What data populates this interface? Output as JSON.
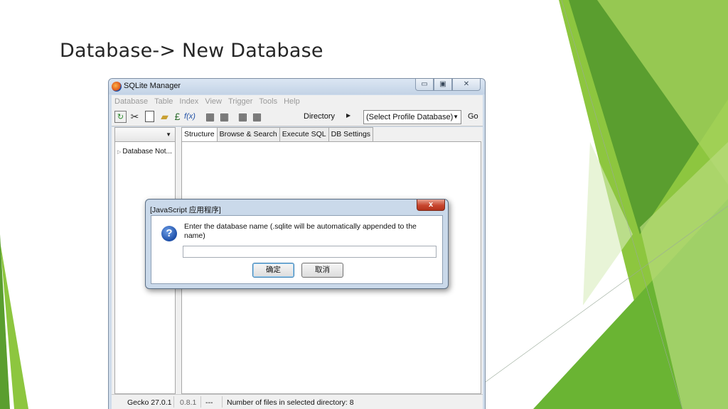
{
  "slide": {
    "title": "Database-> New Database"
  },
  "window": {
    "title": "SQLite Manager",
    "menus": [
      "Database",
      "Table",
      "Index",
      "View",
      "Trigger",
      "Tools",
      "Help"
    ],
    "toolbar": {
      "directory_label": "Directory",
      "profile_select": "(Select Profile Database)",
      "go_label": "Go",
      "icons": [
        "refresh-icon",
        "tools-icon",
        "new-file-icon",
        "open-folder-icon",
        "user-function-icon",
        "fx-icon",
        "create-table-icon",
        "drop-table-icon",
        "create-index-icon",
        "drop-index-icon"
      ]
    },
    "left_pane": {
      "tree_item": "Database Not..."
    },
    "tabs": [
      "Structure",
      "Browse & Search",
      "Execute SQL",
      "DB Settings"
    ],
    "status": {
      "gecko": "Gecko 27.0.1",
      "version": "0.8.1",
      "dashes": "---",
      "files": "Number of files in selected directory: 8"
    }
  },
  "dialog": {
    "title": "[JavaScript 应用程序]",
    "message": "Enter the database name (.sqlite will be automatically appended to the name)",
    "input_value": "",
    "ok_label": "确定",
    "cancel_label": "取消",
    "close_symbol": "x"
  },
  "colors": {
    "green_dark": "#5a9e2f",
    "green_light": "#8dc63f",
    "dialog_frame": "#cad9ea"
  }
}
